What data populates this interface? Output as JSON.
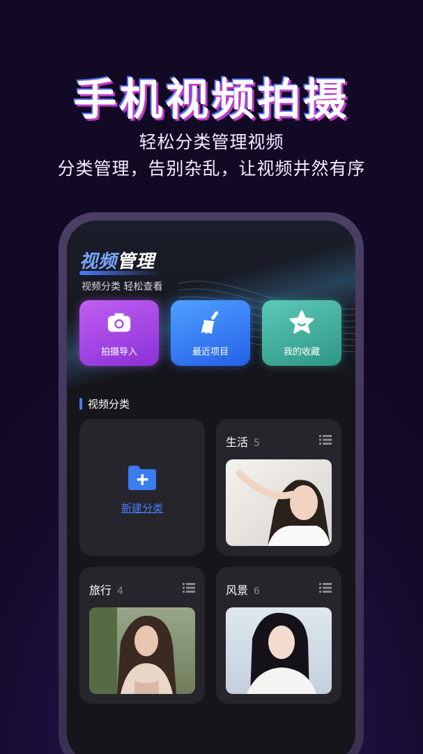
{
  "promo": {
    "title": "手机视频拍摄",
    "subtitle_line1": "轻松分类管理视频",
    "subtitle_line2": "分类管理，告别杂乱，让视频井然有序"
  },
  "app": {
    "title_part1": "视频",
    "title_part2": "管理",
    "subtitle": "视频分类 轻松查看"
  },
  "quick_actions": [
    {
      "label": "拍摄导入",
      "icon": "camera-icon",
      "color": "#a848e6"
    },
    {
      "label": "最近项目",
      "icon": "broom-icon",
      "color": "#3a80f5"
    },
    {
      "label": "我的收藏",
      "icon": "star-icon",
      "color": "#45b0a0"
    }
  ],
  "section": {
    "title": "视频分类"
  },
  "new_category": {
    "label": "新建分类",
    "icon": "folder-plus-icon"
  },
  "categories": [
    {
      "name": "生活",
      "count": "5",
      "icon": "list-icon"
    },
    {
      "name": "旅行",
      "count": "4",
      "icon": "list-icon"
    },
    {
      "name": "风景",
      "count": "6",
      "icon": "list-icon"
    }
  ],
  "colors": {
    "accent": "#4a7bff",
    "background": "#140b2a",
    "card": "#25252b"
  }
}
